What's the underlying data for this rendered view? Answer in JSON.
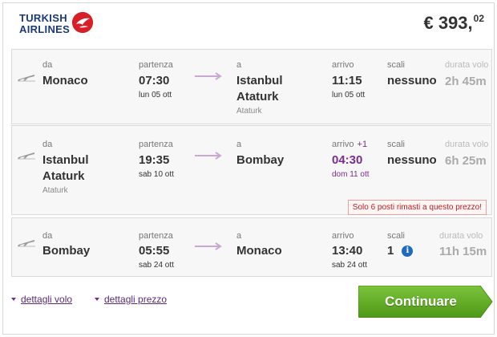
{
  "airline": {
    "name_line1": "TURKISH",
    "name_line2": "AIRLINES",
    "logo_icon": "turkish-airlines-bird-logo",
    "brand_color": "#d62028",
    "text_color": "#1a3a7a"
  },
  "price": {
    "main": "€ 393,",
    "cents": "02"
  },
  "labels": {
    "from": "da",
    "departure": "partenza",
    "to": "a",
    "arrival": "arrivo",
    "stops": "scali",
    "duration": "durata volo"
  },
  "segments": [
    {
      "from_city": "Monaco",
      "dep_time": "07:30",
      "dep_date": "lun 05 ott",
      "to_city_line1": "Istanbul",
      "to_city_line2": "Ataturk",
      "to_airport": "Ataturk",
      "arr_time": "11:15",
      "arr_date": "lun 05 ott",
      "stops": "nessuno",
      "duration": "2h 45m"
    },
    {
      "from_city_line1": "Istanbul",
      "from_city_line2": "Ataturk",
      "from_airport": "Ataturk",
      "dep_time": "19:35",
      "dep_date": "sab 10 ott",
      "to_city": "Bombay",
      "arr_label_extra": "+1",
      "arr_time": "04:30",
      "arr_date": "dom 11 ott",
      "stops": "nessuno",
      "duration": "6h 25m",
      "warning": "Solo 6 posti rimasti a questo prezzo!"
    },
    {
      "from_city": "Bombay",
      "dep_time": "05:55",
      "dep_date": "sab 24 ott",
      "to_city": "Monaco",
      "arr_time": "13:40",
      "arr_date": "sab 24 ott",
      "stops": "1",
      "duration": "11h 15m"
    }
  ],
  "footer": {
    "flight_details": "dettagli volo",
    "price_details": "dettagli prezzo",
    "continue": "Continuare",
    "continue_color": "#5ea51f"
  }
}
